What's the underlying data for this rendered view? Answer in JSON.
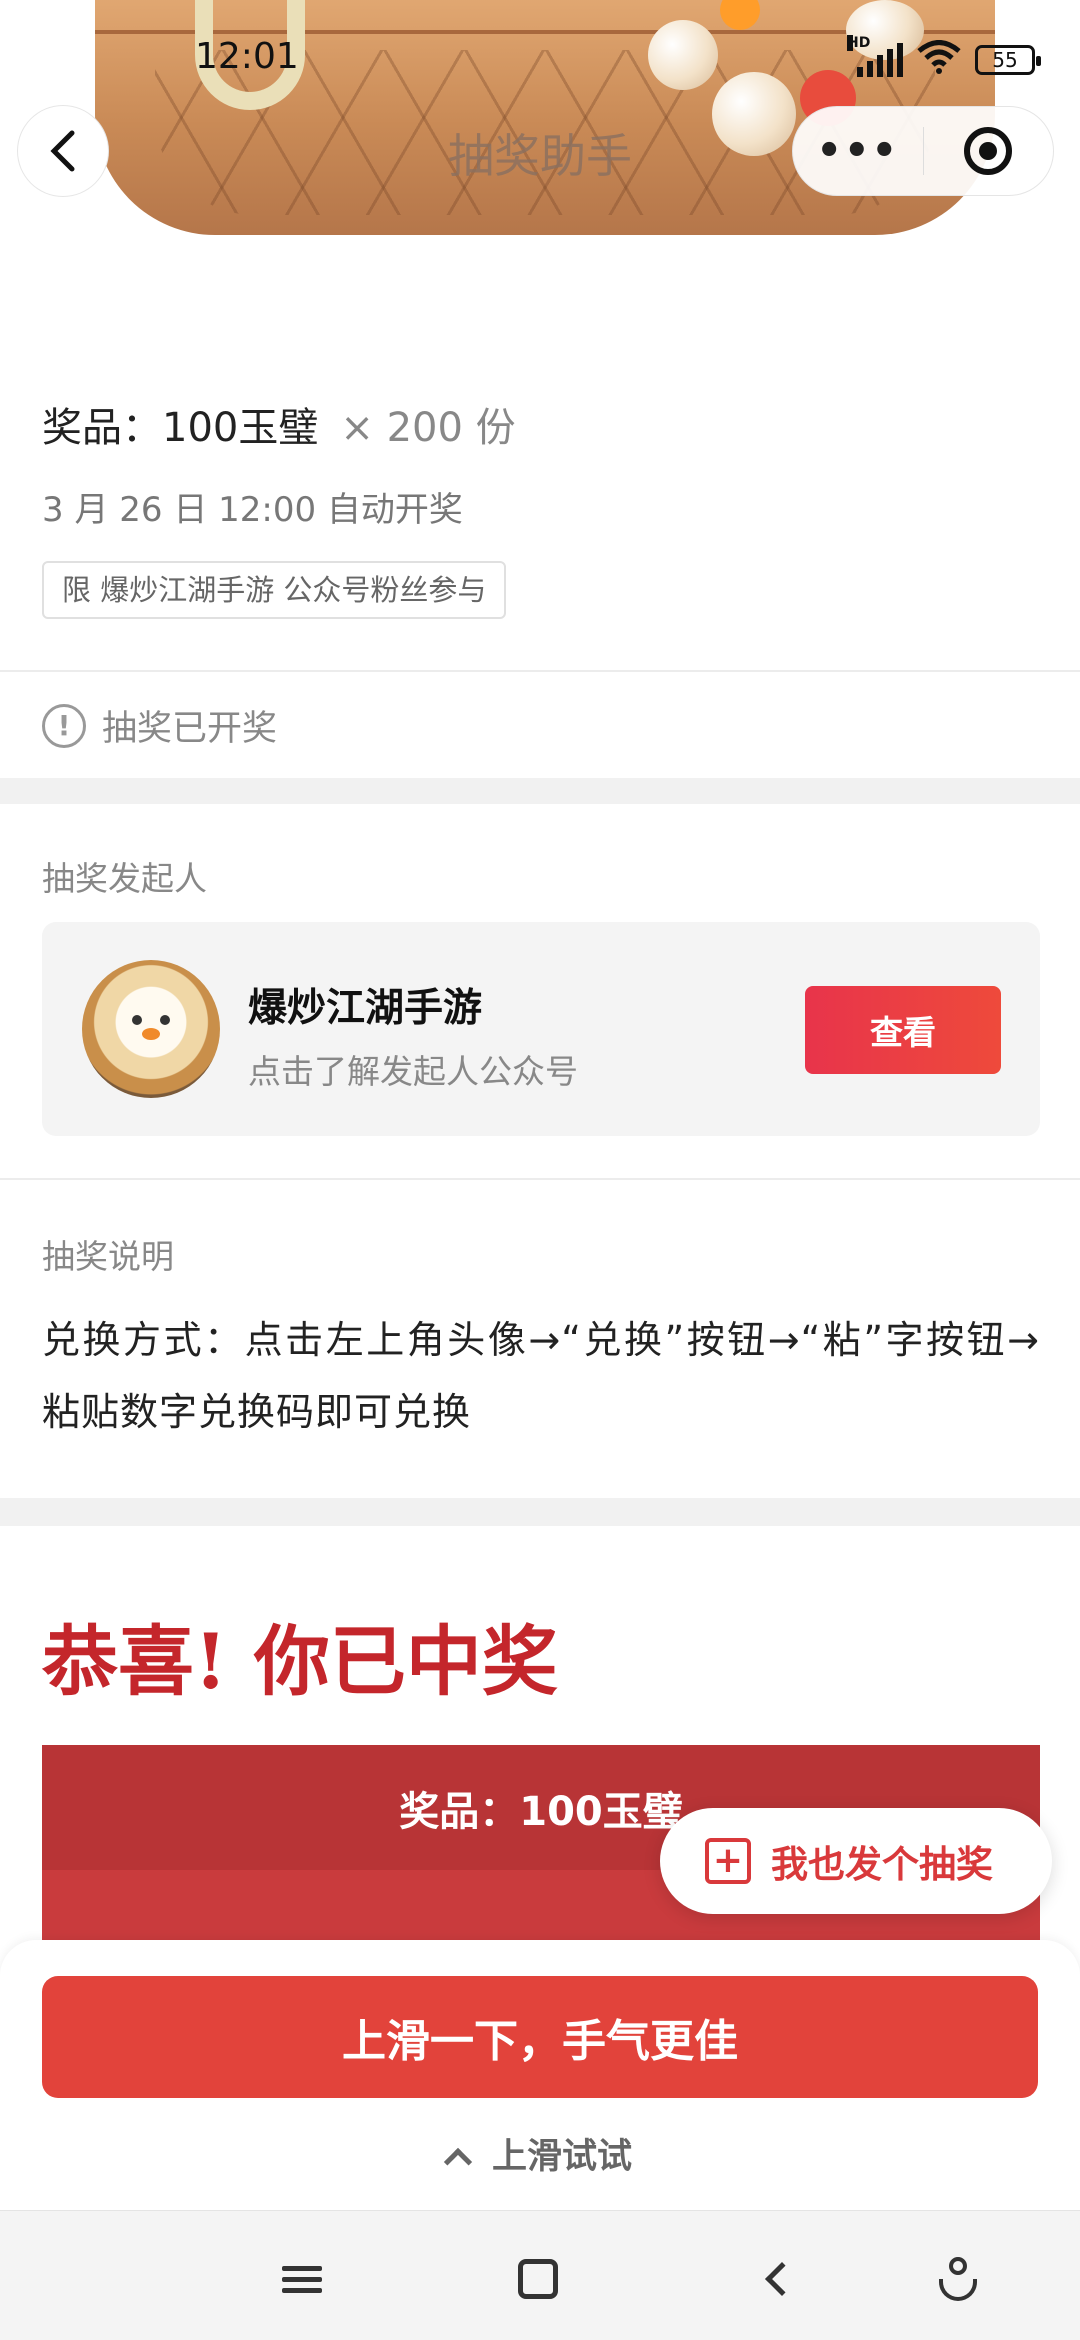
{
  "status_bar": {
    "time": "12:01",
    "network": "HD",
    "battery": "55"
  },
  "nav": {
    "title": "抽奖助手",
    "more_label": "•••"
  },
  "prize": {
    "label": "奖品：100玉璧",
    "quantity": "× 200 份",
    "draw_time": "3 月 26 日 12:00 自动开奖",
    "limit_tag": "限 爆炒江湖手游 公众号粉丝参与",
    "status": "抽奖已开奖"
  },
  "initiator": {
    "section_label": "抽奖发起人",
    "name": "爆炒江湖手游",
    "subtitle": "点击了解发起人公众号",
    "view_button": "查看"
  },
  "description": {
    "section_label": "抽奖说明",
    "text": "兑换方式：点击左上角头像→“兑换”按钮→“粘”字按钮→粘贴数字兑换码即可兑换"
  },
  "result": {
    "congrats": "恭喜! 你已中奖",
    "prize_banner": "奖品：100玉璧"
  },
  "floating": {
    "me_too_label": "我也发个抽奖"
  },
  "bottom_sheet": {
    "swipe_button": "上滑一下，手气更佳",
    "swipe_hint": "上滑试试"
  },
  "colors": {
    "accent_red": "#e2433b",
    "title_red": "#c4262b",
    "muted_text": "#888888"
  }
}
